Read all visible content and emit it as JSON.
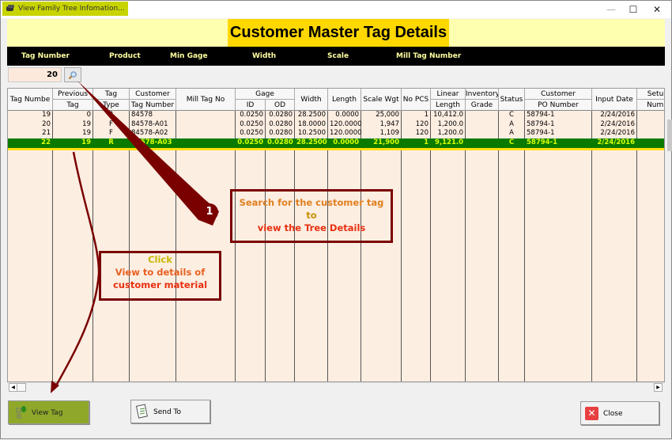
{
  "window": {
    "title": "View Family Tree Infomation...",
    "controls": {
      "minimize": "—",
      "maximize": "☐",
      "close": "✕"
    }
  },
  "header": {
    "title": "Customer Master Tag Details"
  },
  "filter_bar": {
    "labels": [
      "Tag Number",
      "Product",
      "Min Gage",
      "Width",
      "Scale",
      "Mill Tag Number"
    ]
  },
  "search": {
    "value": "20",
    "icon": "magnifier-icon"
  },
  "grid": {
    "headers_top": {
      "tag_number": "Tag Numbe",
      "previous": "Previous",
      "tag": "Tag",
      "customer": "Customer",
      "mill_tag": "Mill Tag No",
      "gage": "Gage",
      "width": "Width",
      "length": "Length",
      "scale_wgt": "Scale Wgt",
      "no_pcs": "No PCS",
      "linear": "Linear",
      "inventory": "Inventory",
      "status": "Status",
      "customer_po": "Customer",
      "input_date": "Input Date",
      "setup": "Setup"
    },
    "headers_bottom": {
      "previous": "Tag",
      "tag": "Type",
      "customer": "Tag Number",
      "gage_id": "ID",
      "gage_od": "OD",
      "linear": "Length",
      "inventory": "Grade",
      "customer_po": "PO Number",
      "setup": "Numb"
    },
    "rows": [
      {
        "tag": "19",
        "prev": "0",
        "type": "R",
        "cust_tag": "84578",
        "mill": "",
        "id": "0.0250",
        "od": "0.0280",
        "width": "28.2500",
        "length": "0.0000",
        "wgt": "25,000",
        "pcs": "1",
        "linear": "10,412.0",
        "grade": "",
        "status": "C",
        "po": "58794-1",
        "date": "2/24/2016",
        "setup": ""
      },
      {
        "tag": "20",
        "prev": "19",
        "type": "F",
        "cust_tag": "84578-A01",
        "mill": "",
        "id": "0.0250",
        "od": "0.0280",
        "width": "18.0000",
        "length": "120.0000",
        "wgt": "1,947",
        "pcs": "120",
        "linear": "1,200.0",
        "grade": "",
        "status": "A",
        "po": "58794-1",
        "date": "2/24/2016",
        "setup": ""
      },
      {
        "tag": "21",
        "prev": "19",
        "type": "F",
        "cust_tag": "84578-A02",
        "mill": "",
        "id": "0.0250",
        "od": "0.0280",
        "width": "10.2500",
        "length": "120.0000",
        "wgt": "1,109",
        "pcs": "120",
        "linear": "1,200.0",
        "grade": "",
        "status": "A",
        "po": "58794-1",
        "date": "2/24/2016",
        "setup": ""
      },
      {
        "tag": "22",
        "prev": "19",
        "type": "R",
        "cust_tag": "84578-A03",
        "mill": "",
        "id": "0.0250",
        "od": "0.0280",
        "width": "28.2500",
        "length": "0.0000",
        "wgt": "21,900",
        "pcs": "1",
        "linear": "9,121.0",
        "grade": "",
        "status": "C",
        "po": "58794-1",
        "date": "2/24/2016",
        "setup": "",
        "selected": true
      }
    ]
  },
  "buttons": {
    "view_tag": "View Tag",
    "send_to": "Send To",
    "close": "Close"
  },
  "annotations": {
    "step_number": "1",
    "search_callout": [
      "Search for the customer tag",
      "to",
      "view the Tree Details"
    ],
    "click_callout": [
      "Click",
      "View to details of",
      "customer material"
    ]
  },
  "colors": {
    "banner": "#ffffb0",
    "title_bg": "#ffd800",
    "selected_row": "#0a7a00",
    "selected_text": "#d8ff00",
    "grid_bg": "#fdeee2",
    "annotation": "#7a0000",
    "view_button": "#8fa82a"
  }
}
